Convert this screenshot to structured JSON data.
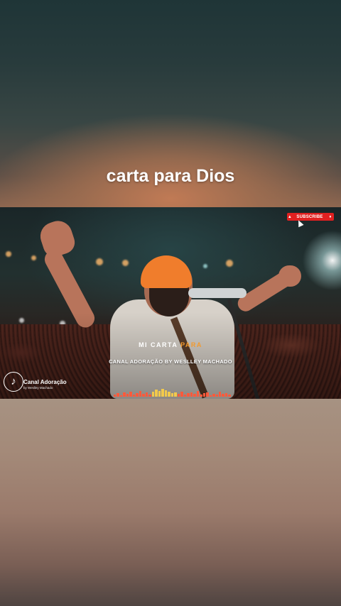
{
  "caption": "carta para Dios",
  "video": {
    "subscribe_label": "SUBSCRIBE",
    "lyric_white": "MI CARTA",
    "lyric_orange": "PARA",
    "channel_caption": "CANAL ADORAÇÃO BY WESLLEY MACHADO",
    "logo_name": "Canal Adoração",
    "logo_sub": "by Weslley Machado",
    "logo_icon": "music-note-icon"
  },
  "colors": {
    "caption_text": "#ffffff",
    "lyric_highlight": "#f39a2e",
    "subscribe_bg": "#e02020"
  }
}
